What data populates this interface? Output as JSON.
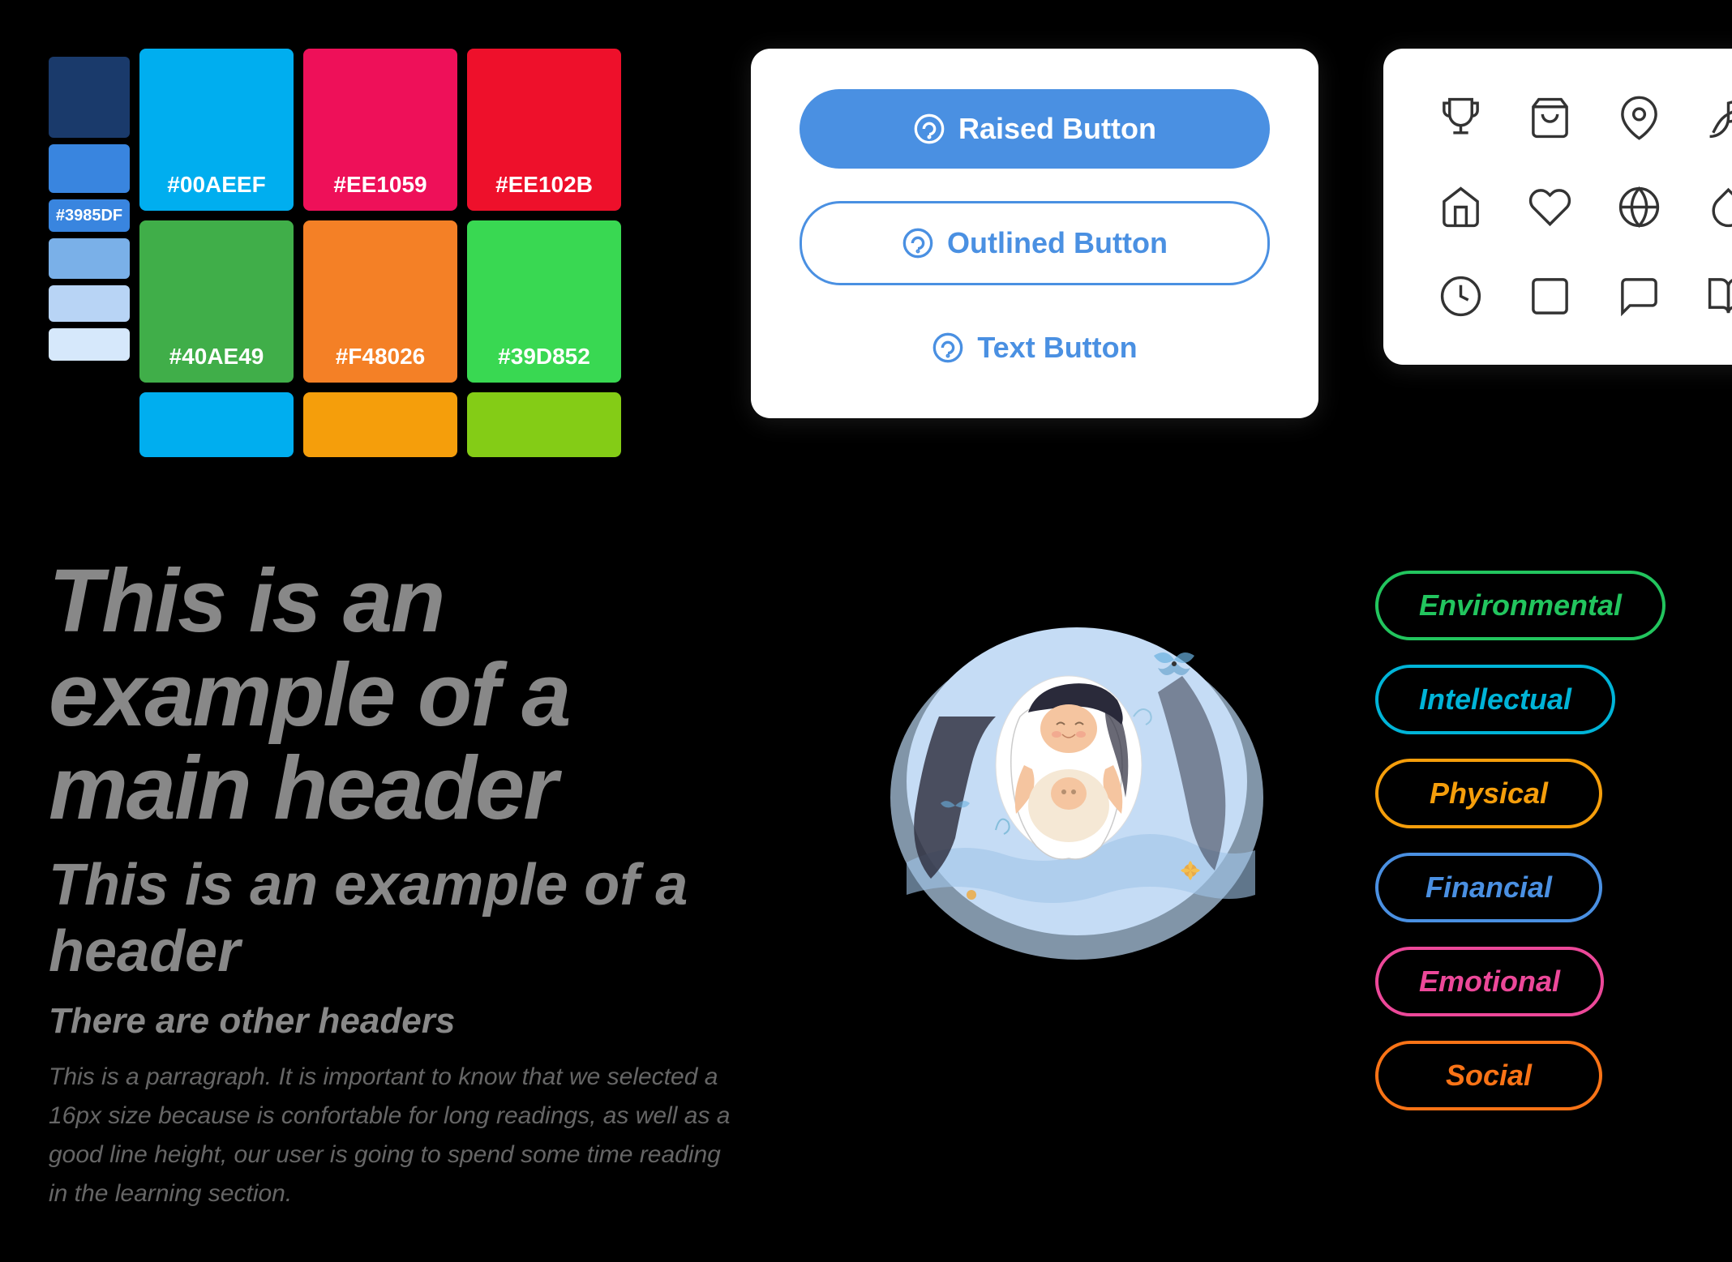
{
  "colors": {
    "cyan": "#00AEEF",
    "pink": "#EE1059",
    "red": "#EE102B",
    "green": "#40AE49",
    "orange": "#F48026",
    "lime": "#39D852",
    "blue": "#3985DF",
    "cyan_label": "#00AEEF",
    "pink_label": "#EE1059",
    "red_label": "#EE102B",
    "green_label": "#40AE49",
    "orange_label": "#F48026",
    "lime_label": "#39D852",
    "blue_label": "#3985DF"
  },
  "buttons": {
    "raised_label": "Raised Button",
    "outlined_label": "Outlined Button",
    "text_label": "Text Button"
  },
  "typography": {
    "main_header": "This is an example of a main header",
    "sub_header": "This is an example of a header",
    "small_header": "There are other headers",
    "paragraph": "This is a parragraph. It is important to know that we selected a 16px size because is confortable for long readings, as well as a good line height, our user is going to spend some time reading in the learning section."
  },
  "tags": {
    "environmental": "Environmental",
    "intellectual": "Intellectual",
    "physical": "Physical",
    "financial": "Financial",
    "emotional": "Emotional",
    "social": "Social"
  }
}
